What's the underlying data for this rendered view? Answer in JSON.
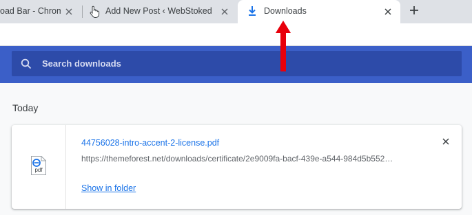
{
  "tabs": [
    {
      "title": "oad Bar - Chrome"
    },
    {
      "title": "Add New Post ‹ WebStoked — W"
    },
    {
      "title": "Downloads",
      "active": true
    }
  ],
  "newtab_icon": "plus-icon",
  "search": {
    "placeholder": "Search downloads",
    "value": ""
  },
  "section": {
    "date": "Today"
  },
  "download": {
    "file_name": "44756028-intro-accent-2-license.pdf",
    "url": "https://themeforest.net/downloads/certificate/2e9009fa-bacf-439e-a544-984d5b552…",
    "show_in_folder": "Show in folder",
    "file_icon": "pdf-file-icon",
    "file_icon_label": "pdf"
  },
  "colors": {
    "header": "#3b5fc8",
    "search_box": "#2d4ba9",
    "link": "#1a73e8",
    "annotation_arrow": "#e8000b"
  }
}
